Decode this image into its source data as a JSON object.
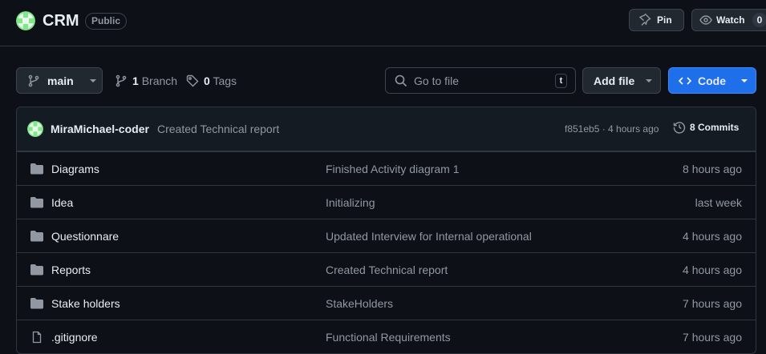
{
  "repo": {
    "name": "CRM",
    "visibility": "Public",
    "pin_label": "Pin",
    "watch_label": "Watch",
    "watch_count": "0"
  },
  "toolbar": {
    "branch": "main",
    "branch_count": "1",
    "branch_label": "Branch",
    "tag_count": "0",
    "tag_label": "Tags",
    "search_placeholder": "Go to file",
    "search_shortcut": "t",
    "add_file_label": "Add file",
    "code_label": "Code"
  },
  "latest_commit": {
    "author": "MiraMichael-coder",
    "message": "Created Technical report",
    "meta": "f851eb5 · 4 hours ago",
    "commits_label": "8 Commits"
  },
  "files": [
    {
      "icon": "folder-icon",
      "name": "Diagrams",
      "message": "Finished Activity diagram 1",
      "time": "8 hours ago"
    },
    {
      "icon": "folder-icon",
      "name": "Idea",
      "message": "Initializing",
      "time": "last week"
    },
    {
      "icon": "folder-icon",
      "name": "Questionnare",
      "message": "Updated Interview for Internal operational",
      "time": "4 hours ago"
    },
    {
      "icon": "folder-icon",
      "name": "Reports",
      "message": "Created Technical report",
      "time": "4 hours ago"
    },
    {
      "icon": "folder-icon",
      "name": "Stake holders",
      "message": "StakeHolders",
      "time": "7 hours ago"
    },
    {
      "icon": "file-icon",
      "name": ".gitignore",
      "message": "Functional Requirements",
      "time": "7 hours ago"
    }
  ],
  "colors": {
    "background": "#0d1117",
    "border": "#30363d",
    "muted_text": "#9198a1",
    "primary_button": "#1f6feb",
    "avatar_green": "#7ee787"
  }
}
